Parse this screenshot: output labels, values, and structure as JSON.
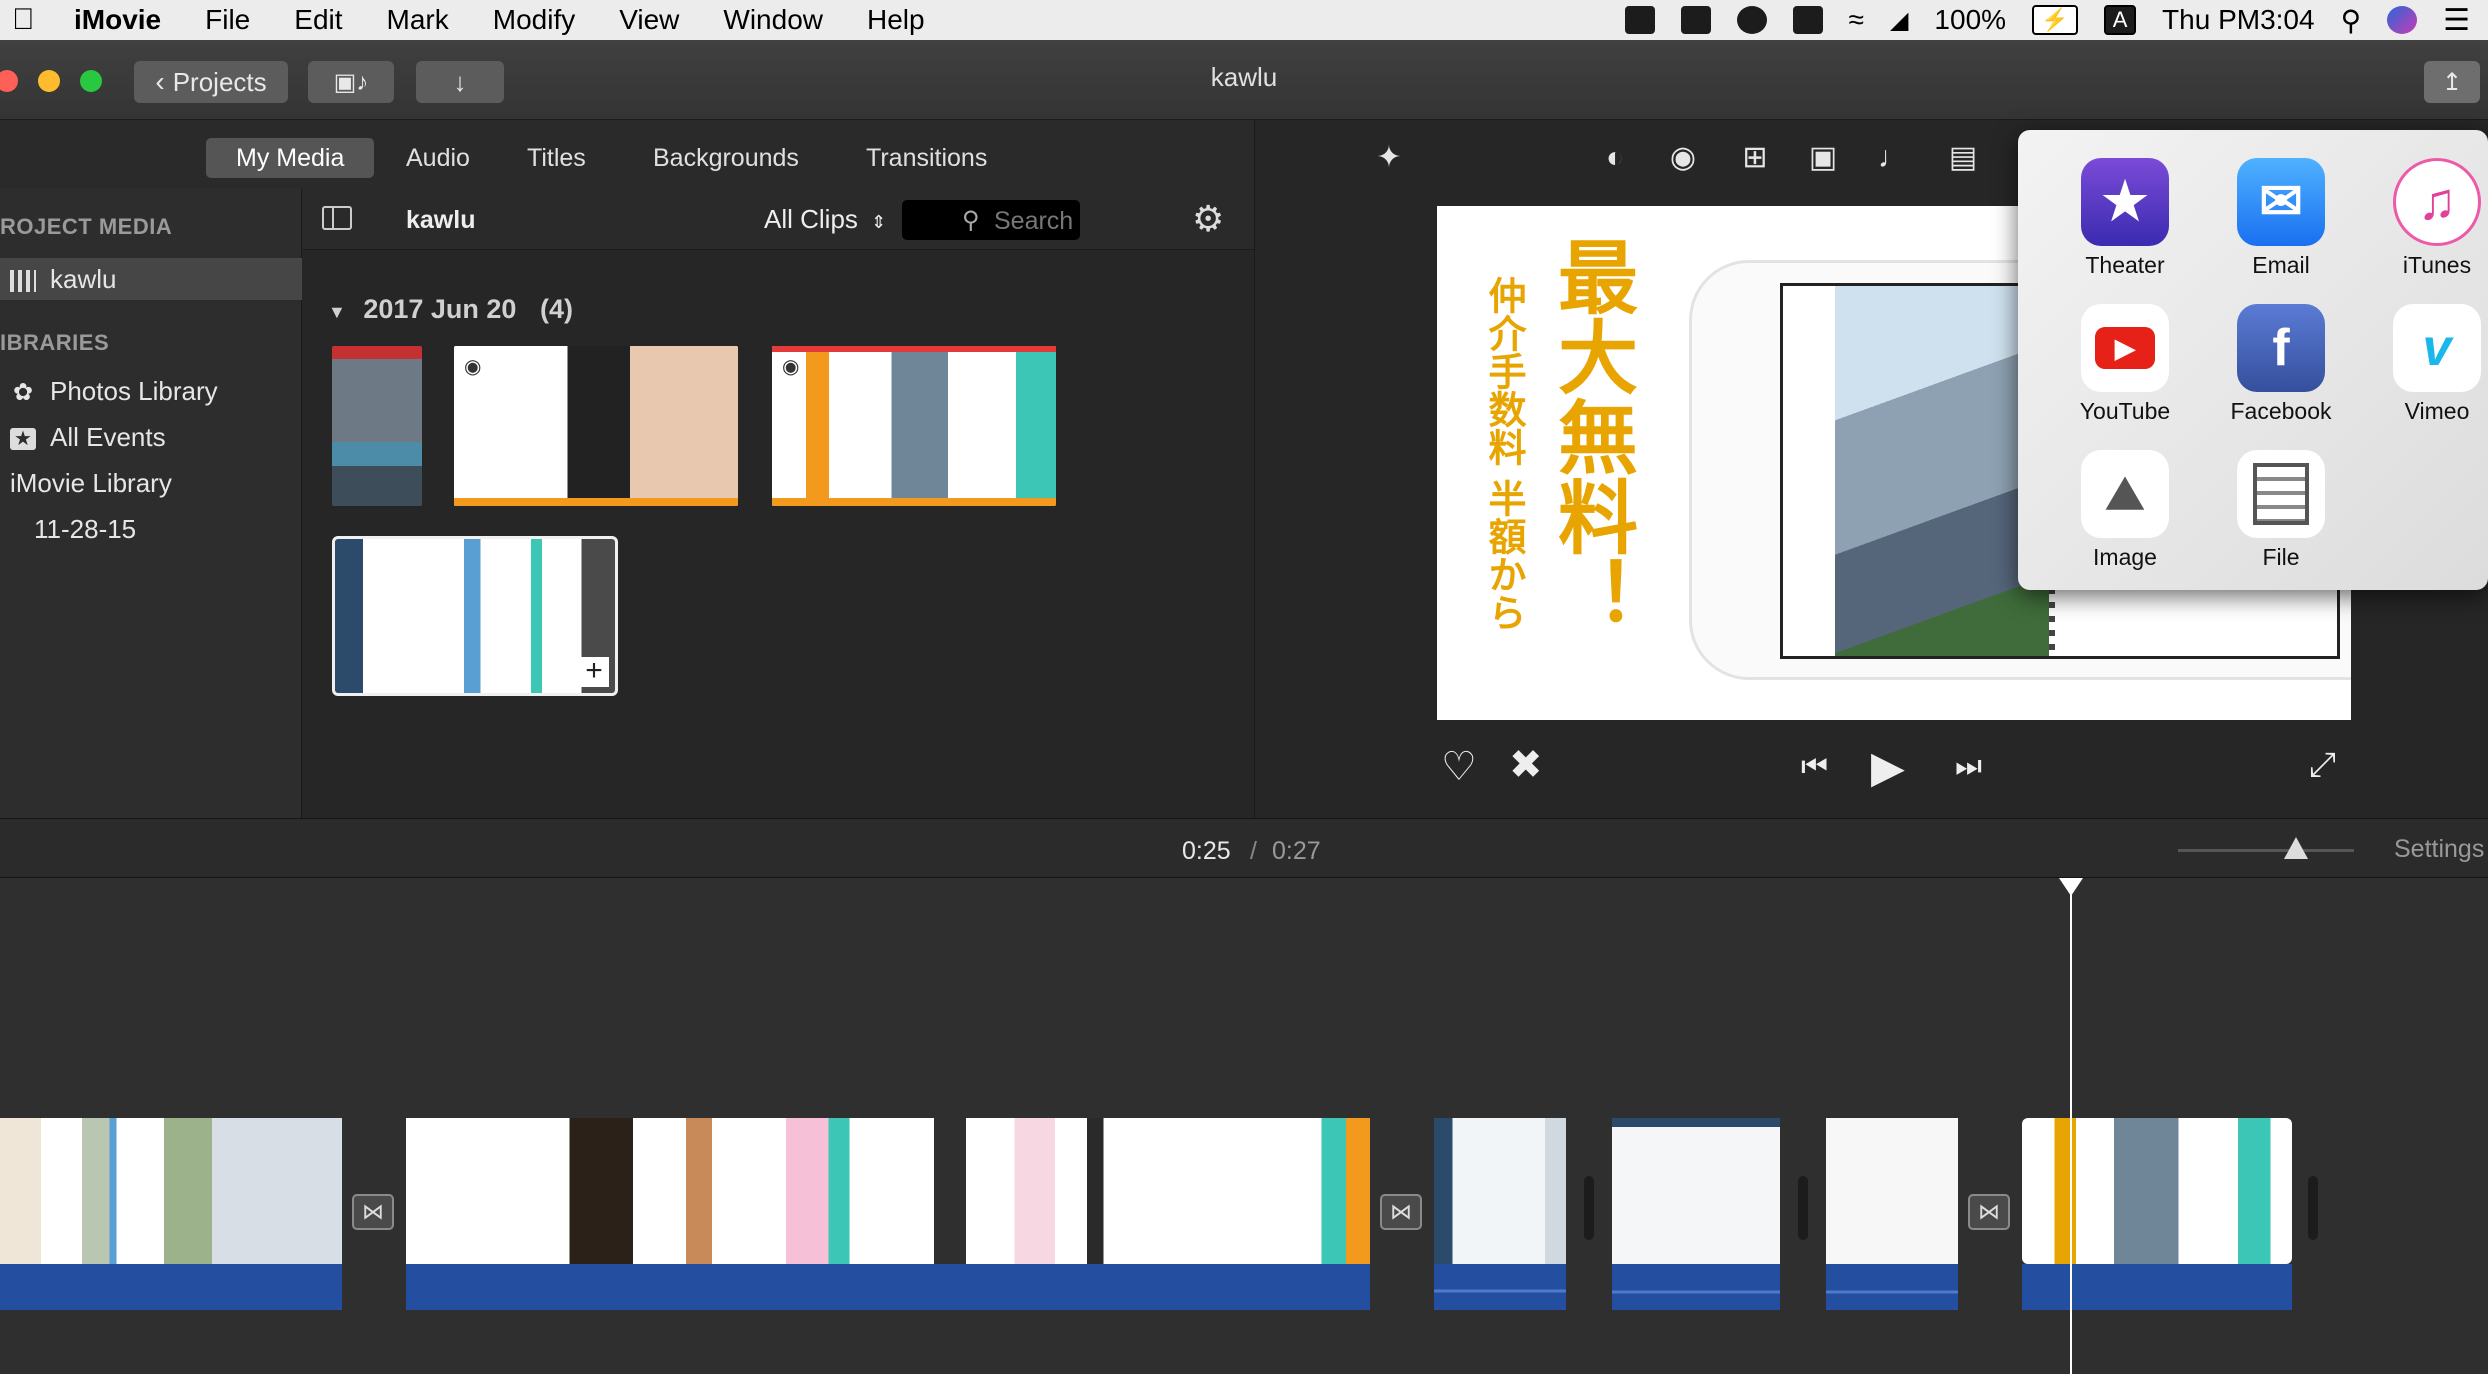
{
  "menubar": {
    "app": "iMovie",
    "items": [
      "File",
      "Edit",
      "Mark",
      "Modify",
      "View",
      "Window",
      "Help"
    ],
    "battery": "100%",
    "input_source": "A",
    "clock": "Thu PM3:04"
  },
  "toolbar": {
    "projects_label": "Projects",
    "window_title": "kawlu"
  },
  "browser_tabs": [
    "My Media",
    "Audio",
    "Titles",
    "Backgrounds",
    "Transitions"
  ],
  "sidebar": {
    "project_media_header": "ROJECT MEDIA",
    "project_item": "kawlu",
    "libraries_header": "IBRARIES",
    "libraries": [
      "Photos Library",
      "All Events",
      "iMovie Library",
      "11-28-15"
    ]
  },
  "media": {
    "title": "kawlu",
    "filter": "All Clips",
    "search_placeholder": "Search",
    "group_date": "2017 Jun 20",
    "group_count": "(4)"
  },
  "viewer": {
    "headline": "最大無料！",
    "subline": "仲介手数料 半額から"
  },
  "share": {
    "items": [
      "Theater",
      "Email",
      "iTunes",
      "YouTube",
      "Facebook",
      "Vimeo",
      "Image",
      "File"
    ]
  },
  "timeline": {
    "current": "0:25",
    "separator": "/",
    "total": "0:27",
    "settings": "Settings"
  },
  "colors": {
    "accent_orange": "#f39a1e",
    "headline_yellow": "#e8a400",
    "audio_blue": "#244ea0",
    "teal": "#3bc6b5"
  }
}
